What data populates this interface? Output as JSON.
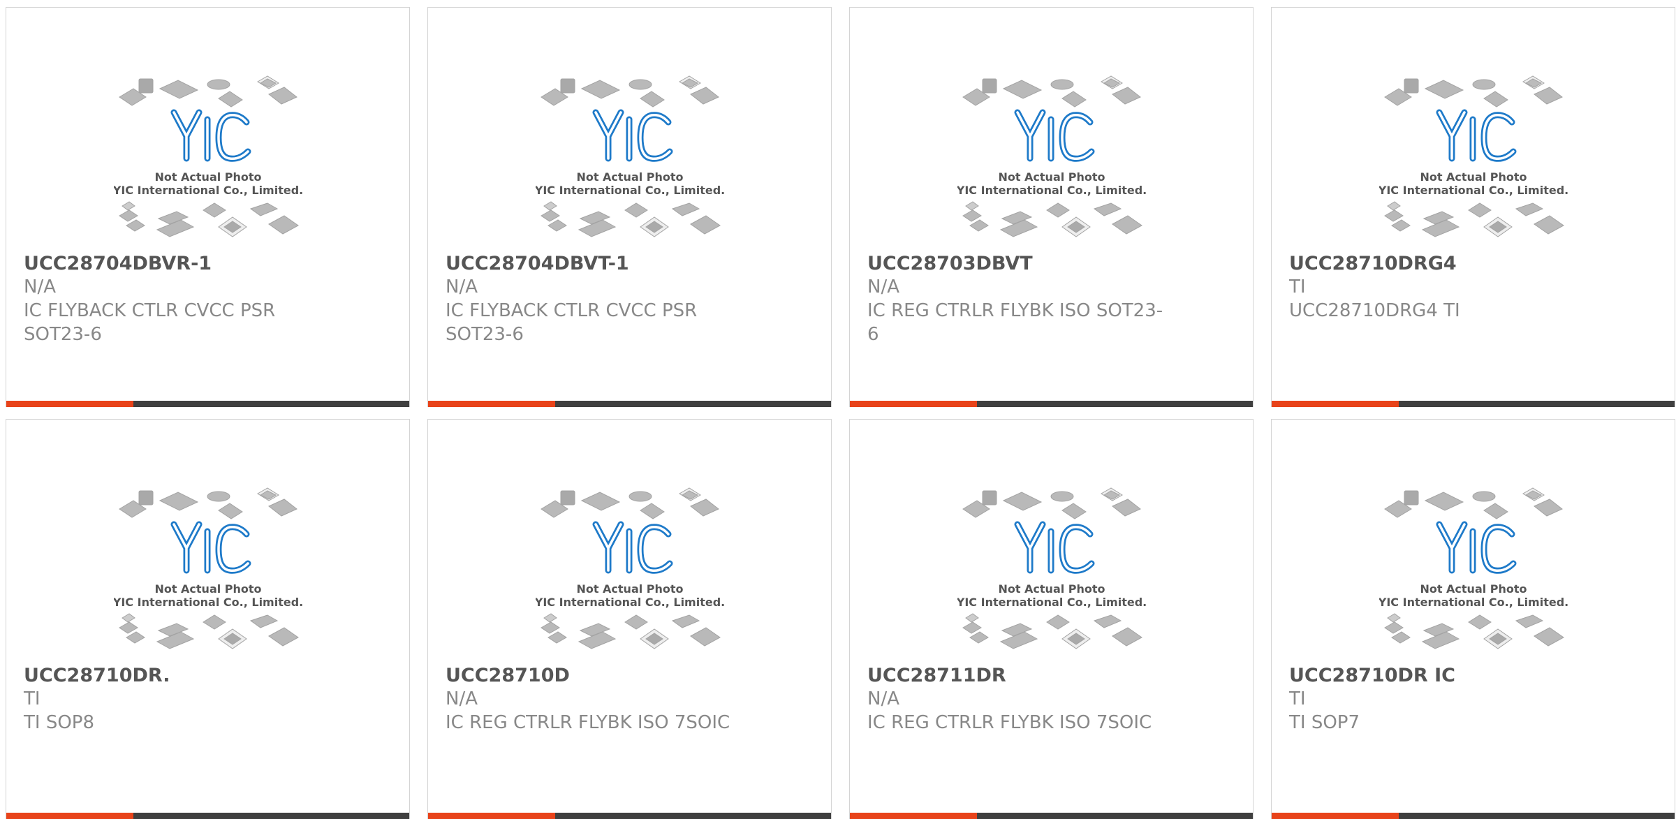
{
  "theme": {
    "accent": "#e8431a",
    "bar": "#3f3f3f",
    "logo": "#1e7ac9"
  },
  "photo": {
    "logo_text": "YIC",
    "line1": "Not Actual Photo",
    "line2": "YIC International Co., Limited."
  },
  "products": [
    {
      "part": "UCC28704DBVR-1",
      "maker": "N/A",
      "desc": "IC FLYBACK CTLR CVCC PSR SOT23-6"
    },
    {
      "part": "UCC28704DBVT-1",
      "maker": "N/A",
      "desc": "IC FLYBACK CTLR CVCC PSR SOT23-6"
    },
    {
      "part": "UCC28703DBVT",
      "maker": "N/A",
      "desc": "IC REG CTRLR FLYBK ISO SOT23-6"
    },
    {
      "part": "UCC28710DRG4",
      "maker": "TI",
      "desc": "UCC28710DRG4 TI"
    },
    {
      "part": "UCC28710DR.",
      "maker": "TI",
      "desc": "TI SOP8"
    },
    {
      "part": "UCC28710D",
      "maker": "N/A",
      "desc": "IC REG CTRLR FLYBK ISO 7SOIC"
    },
    {
      "part": "UCC28711DR",
      "maker": "N/A",
      "desc": "IC REG CTRLR FLYBK ISO 7SOIC"
    },
    {
      "part": "UCC28710DR IC",
      "maker": "TI",
      "desc": "TI SOP7"
    }
  ]
}
